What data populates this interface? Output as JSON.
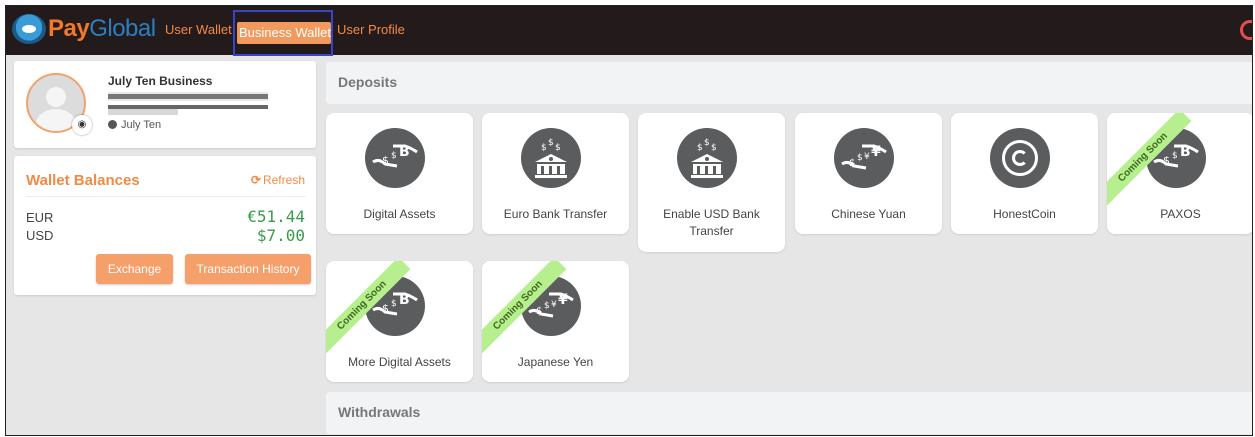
{
  "brand": {
    "pay": "Pay",
    "global": "Global"
  },
  "nav": {
    "user_wallet": "User Wallet",
    "business_wallet": "Business Wallet",
    "user_profile": "User Profile"
  },
  "profile": {
    "business_name": "July Ten Business",
    "owner_name": "July Ten"
  },
  "wallet": {
    "title": "Wallet Balances",
    "refresh_label": "Refresh",
    "balances": [
      {
        "currency": "EUR",
        "amount": "€51.44"
      },
      {
        "currency": "USD",
        "amount": "$7.00"
      }
    ],
    "exchange_label": "Exchange",
    "history_label": "Transaction History"
  },
  "deposits": {
    "title": "Deposits",
    "tiles": [
      {
        "label": "Digital Assets",
        "icon": "hand-crypto-icon",
        "coming_soon": false
      },
      {
        "label": "Euro Bank Transfer",
        "icon": "bank-icon",
        "coming_soon": false
      },
      {
        "label": "Enable USD Bank Transfer",
        "icon": "bank-icon",
        "coming_soon": false
      },
      {
        "label": "Chinese Yuan",
        "icon": "hand-yuan-icon",
        "coming_soon": false
      },
      {
        "label": "HonestCoin",
        "icon": "honestcoin-icon",
        "coming_soon": false
      },
      {
        "label": "PAXOS",
        "icon": "hand-crypto-icon",
        "coming_soon": true
      },
      {
        "label": "More Digital Assets",
        "icon": "hand-crypto-icon",
        "coming_soon": true
      },
      {
        "label": "Japanese Yen",
        "icon": "hand-yen-icon",
        "coming_soon": true
      }
    ],
    "coming_soon_label": "Coming Soon"
  },
  "withdrawals": {
    "title": "Withdrawals"
  },
  "colors": {
    "accent": "#f28a45",
    "positive": "#3a9c4a",
    "topbar": "#231a1b",
    "ribbon": "#b7ef8e"
  }
}
